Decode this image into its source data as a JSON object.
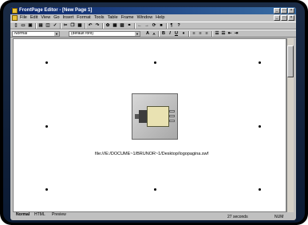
{
  "window": {
    "title": "FrontPage Editor - [New Page 1]",
    "controls": [
      "minimize-icon",
      "maximize-icon",
      "close-icon"
    ]
  },
  "menubar": {
    "items": [
      "File",
      "Edit",
      "View",
      "Go",
      "Insert",
      "Format",
      "Tools",
      "Table",
      "Frame",
      "Window",
      "Help"
    ]
  },
  "toolbar": {
    "style_value": "Normal",
    "font_value": "(default font)"
  },
  "editor": {
    "image_alt": "plug-image",
    "file_path": "file:///E:/DOCUME~1/BRUNOR~1/Desktop/logopagina.swf"
  },
  "tabs": {
    "items": [
      "Normal",
      "HTML",
      "Preview"
    ]
  },
  "status": {
    "time": "27 seconds",
    "num": "NUM"
  }
}
